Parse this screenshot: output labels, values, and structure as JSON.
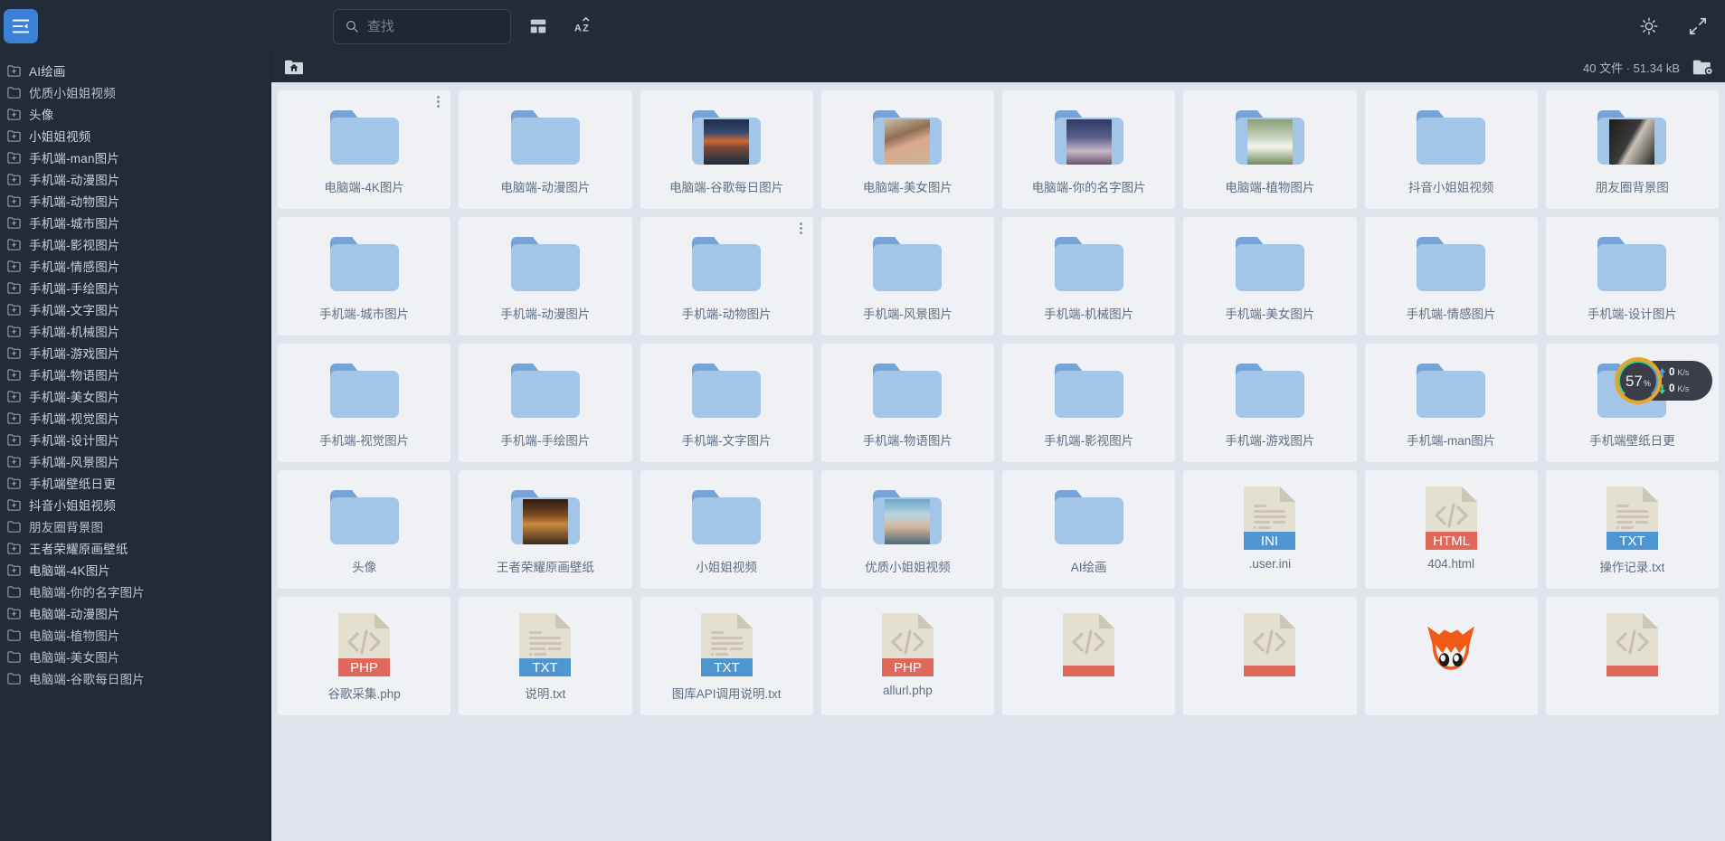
{
  "toolbar": {
    "collapse_icon": "sidebar-collapse-icon",
    "search_placeholder": "查找",
    "search_value": "",
    "search_icon": "search-icon",
    "layout_icon": "grid-layout-icon",
    "sort_icon": "sort-az-icon",
    "brightness_icon": "brightness-sun-icon",
    "fullscreen_icon": "fullscreen-expand-icon"
  },
  "breadcrumb": {
    "home_icon": "home-folder-icon",
    "count_text": "40 文件 · 51.34 kB",
    "settings_icon": "folder-settings-icon"
  },
  "sidebar": {
    "items": [
      {
        "label": "AI绘画",
        "icon": "folder-plus-icon"
      },
      {
        "label": "优质小姐姐视频",
        "icon": "folder-icon"
      },
      {
        "label": "头像",
        "icon": "folder-plus-icon"
      },
      {
        "label": "小姐姐视频",
        "icon": "folder-plus-icon"
      },
      {
        "label": "手机端-man图片",
        "icon": "folder-plus-icon"
      },
      {
        "label": "手机端-动漫图片",
        "icon": "folder-plus-icon"
      },
      {
        "label": "手机端-动物图片",
        "icon": "folder-plus-icon"
      },
      {
        "label": "手机端-城市图片",
        "icon": "folder-plus-icon"
      },
      {
        "label": "手机端-影视图片",
        "icon": "folder-plus-icon"
      },
      {
        "label": "手机端-情感图片",
        "icon": "folder-plus-icon"
      },
      {
        "label": "手机端-手绘图片",
        "icon": "folder-plus-icon"
      },
      {
        "label": "手机端-文字图片",
        "icon": "folder-plus-icon"
      },
      {
        "label": "手机端-机械图片",
        "icon": "folder-plus-icon"
      },
      {
        "label": "手机端-游戏图片",
        "icon": "folder-plus-icon"
      },
      {
        "label": "手机端-物语图片",
        "icon": "folder-plus-icon"
      },
      {
        "label": "手机端-美女图片",
        "icon": "folder-plus-icon"
      },
      {
        "label": "手机端-视觉图片",
        "icon": "folder-plus-icon"
      },
      {
        "label": "手机端-设计图片",
        "icon": "folder-plus-icon"
      },
      {
        "label": "手机端-风景图片",
        "icon": "folder-plus-icon"
      },
      {
        "label": "手机端壁纸日更",
        "icon": "folder-plus-icon"
      },
      {
        "label": "抖音小姐姐视频",
        "icon": "folder-plus-icon"
      },
      {
        "label": "朋友圈背景图",
        "icon": "folder-icon"
      },
      {
        "label": "王者荣耀原画壁纸",
        "icon": "folder-plus-icon"
      },
      {
        "label": "电脑端-4K图片",
        "icon": "folder-plus-icon"
      },
      {
        "label": "电脑端-你的名字图片",
        "icon": "folder-icon"
      },
      {
        "label": "电脑端-动漫图片",
        "icon": "folder-plus-icon"
      },
      {
        "label": "电脑端-植物图片",
        "icon": "folder-icon"
      },
      {
        "label": "电脑端-美女图片",
        "icon": "folder-icon"
      },
      {
        "label": "电脑端-谷歌每日图片",
        "icon": "folder-icon"
      }
    ]
  },
  "grid": {
    "items": [
      {
        "label": "电脑端-4K图片",
        "kind": "folder",
        "thumb": "",
        "menu": true
      },
      {
        "label": "电脑端-动漫图片",
        "kind": "folder",
        "thumb": ""
      },
      {
        "label": "电脑端-谷歌每日图片",
        "kind": "folder-thumb",
        "thumb": "mountain-sunset"
      },
      {
        "label": "电脑端-美女图片",
        "kind": "folder-thumb",
        "thumb": "portrait-woman"
      },
      {
        "label": "电脑端-你的名字图片",
        "kind": "folder-thumb",
        "thumb": "anime-pair"
      },
      {
        "label": "电脑端-植物图片",
        "kind": "folder-thumb",
        "thumb": "white-flower"
      },
      {
        "label": "抖音小姐姐视频",
        "kind": "folder",
        "thumb": ""
      },
      {
        "label": "朋友圈背景图",
        "kind": "folder-thumb",
        "thumb": "dark-text-card"
      },
      {
        "label": "手机端-城市图片",
        "kind": "folder",
        "thumb": ""
      },
      {
        "label": "手机端-动漫图片",
        "kind": "folder",
        "thumb": ""
      },
      {
        "label": "手机端-动物图片",
        "kind": "folder",
        "thumb": "",
        "menu": true
      },
      {
        "label": "手机端-风景图片",
        "kind": "folder",
        "thumb": ""
      },
      {
        "label": "手机端-机械图片",
        "kind": "folder",
        "thumb": ""
      },
      {
        "label": "手机端-美女图片",
        "kind": "folder",
        "thumb": ""
      },
      {
        "label": "手机端-情感图片",
        "kind": "folder",
        "thumb": ""
      },
      {
        "label": "手机端-设计图片",
        "kind": "folder",
        "thumb": ""
      },
      {
        "label": "手机端-视觉图片",
        "kind": "folder",
        "thumb": ""
      },
      {
        "label": "手机端-手绘图片",
        "kind": "folder",
        "thumb": ""
      },
      {
        "label": "手机端-文字图片",
        "kind": "folder",
        "thumb": ""
      },
      {
        "label": "手机端-物语图片",
        "kind": "folder",
        "thumb": ""
      },
      {
        "label": "手机端-影视图片",
        "kind": "folder",
        "thumb": ""
      },
      {
        "label": "手机端-游戏图片",
        "kind": "folder",
        "thumb": ""
      },
      {
        "label": "手机端-man图片",
        "kind": "folder",
        "thumb": ""
      },
      {
        "label": "手机端壁纸日更",
        "kind": "folder",
        "thumb": ""
      },
      {
        "label": "头像",
        "kind": "folder",
        "thumb": ""
      },
      {
        "label": "王者荣耀原画壁纸",
        "kind": "folder-thumb",
        "thumb": "game-art"
      },
      {
        "label": "小姐姐视频",
        "kind": "folder",
        "thumb": ""
      },
      {
        "label": "优质小姐姐视频",
        "kind": "folder-thumb",
        "thumb": "photo-girl"
      },
      {
        "label": "AI绘画",
        "kind": "folder",
        "thumb": ""
      },
      {
        "label": ".user.ini",
        "kind": "file",
        "ext": "INI",
        "ext_color": "#4f95d1",
        "glyph": "lines"
      },
      {
        "label": "404.html",
        "kind": "file",
        "ext": "HTML",
        "ext_color": "#e0685a",
        "glyph": "code"
      },
      {
        "label": "操作记录.txt",
        "kind": "file",
        "ext": "TXT",
        "ext_color": "#4f95d1",
        "glyph": "lines"
      },
      {
        "label": "谷歌采集.php",
        "kind": "file",
        "ext": "PHP",
        "ext_color": "#e0685a",
        "glyph": "code"
      },
      {
        "label": "说明.txt",
        "kind": "file",
        "ext": "TXT",
        "ext_color": "#4f95d1",
        "glyph": "lines"
      },
      {
        "label": "图库API调用说明.txt",
        "kind": "file",
        "ext": "TXT",
        "ext_color": "#4f95d1",
        "glyph": "lines"
      },
      {
        "label": "allurl.php",
        "kind": "file",
        "ext": "PHP",
        "ext_color": "#e0685a",
        "glyph": "code"
      },
      {
        "label": "",
        "kind": "file",
        "ext": "",
        "ext_color": "#e0685a",
        "glyph": "code"
      },
      {
        "label": "",
        "kind": "file",
        "ext": "",
        "ext_color": "#e0685a",
        "glyph": "code"
      },
      {
        "label": "",
        "kind": "image",
        "thumb": "fox-mascot"
      },
      {
        "label": "",
        "kind": "file",
        "ext": "",
        "ext_color": "#e0685a",
        "glyph": "code"
      }
    ]
  },
  "widget": {
    "percent": "57",
    "percent_symbol": "%",
    "upload_value": "0",
    "upload_unit": "K/s",
    "download_value": "0",
    "download_unit": "K/s",
    "ring_color": "#e8a52a",
    "up_arrow_color": "#4aa3df",
    "down_arrow_color": "#3fcf8e"
  }
}
